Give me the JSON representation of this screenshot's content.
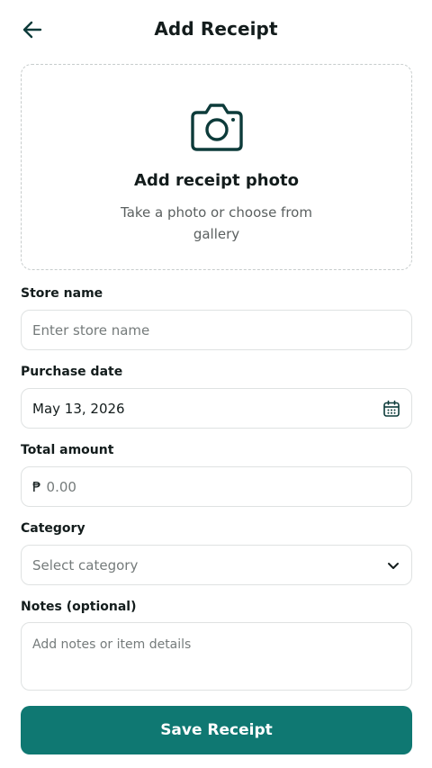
{
  "header": {
    "title": "Add Receipt",
    "back_icon": "arrow-left-icon"
  },
  "upload": {
    "icon": "camera-icon",
    "title": "Add receipt photo",
    "subtitle": "Take a photo or choose from gallery"
  },
  "form": {
    "store": {
      "label": "Store name",
      "placeholder": "Enter store name",
      "value": ""
    },
    "date": {
      "label": "Purchase date",
      "value": "May 13, 2026",
      "icon": "calendar-icon"
    },
    "amount": {
      "label": "Total amount",
      "currency_symbol": "₱",
      "placeholder": "0.00",
      "value": ""
    },
    "category": {
      "label": "Category",
      "placeholder": "Select category",
      "icon": "chevron-down-icon"
    },
    "notes": {
      "label": "Notes (optional)",
      "placeholder": "Add notes or item details",
      "value": ""
    }
  },
  "actions": {
    "save_label": "Save Receipt"
  },
  "colors": {
    "accent": "#0f7872",
    "icon": "#0d3b3a",
    "border": "#dfe2e2",
    "dashed_border": "#c7cccc"
  }
}
